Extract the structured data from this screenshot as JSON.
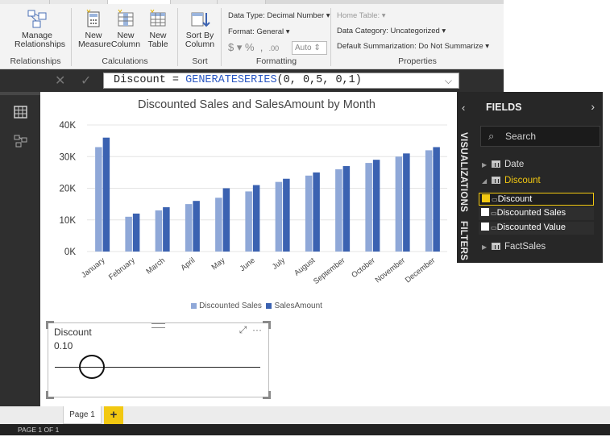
{
  "ribbon": {
    "groups": {
      "relationships": {
        "label": "Relationships",
        "button": "Manage\nRelationships"
      },
      "calculations": {
        "label": "Calculations",
        "new_measure": "New\nMeasure",
        "new_column": "New\nColumn",
        "new_table": "New\nTable"
      },
      "sort": {
        "label": "Sort",
        "sort_by_column": "Sort By\nColumn"
      },
      "formatting": {
        "label": "Formatting",
        "data_type": "Data Type: Decimal Number",
        "format": "Format: General",
        "auto": "Auto"
      },
      "properties": {
        "label": "Properties",
        "home_table": "Home Table:",
        "data_category": "Data Category: Uncategorized",
        "default_summarization": "Default Summarization: Do Not Summarize"
      }
    }
  },
  "formula": {
    "prefix": "Discount = ",
    "fn": "GENERATESERIES",
    "args": "(0, 0,5, 0,1)"
  },
  "chart_data": {
    "type": "bar",
    "title": "Discounted Sales and SalesAmount by Month",
    "categories": [
      "January",
      "February",
      "March",
      "April",
      "May",
      "June",
      "July",
      "August",
      "September",
      "October",
      "November",
      "December"
    ],
    "series": [
      {
        "name": "Discounted Sales",
        "color": "#8fa8d8",
        "values": [
          33000,
          11000,
          13000,
          15000,
          17000,
          19000,
          22000,
          24000,
          26000,
          28000,
          30000,
          32000
        ]
      },
      {
        "name": "SalesAmount",
        "color": "#3b62b1",
        "values": [
          36000,
          12000,
          14000,
          16000,
          20000,
          21000,
          23000,
          25000,
          27000,
          29000,
          31000,
          33000
        ]
      }
    ],
    "yticks": [
      "0K",
      "10K",
      "20K",
      "30K",
      "40K"
    ],
    "ylim": [
      0,
      40000
    ],
    "grid": true,
    "legend": "bottom"
  },
  "slicer": {
    "title": "Discount",
    "value": "0.10",
    "level": 0.2
  },
  "side": {
    "visualizations_label": "VISUALIZATIONS",
    "filters_label": "FILTERS"
  },
  "fields": {
    "header": "FIELDS",
    "search_placeholder": "Search",
    "tables": {
      "date": "Date",
      "discount": "Discount",
      "factsales": "FactSales"
    },
    "discount_fields": [
      "Discount",
      "Discounted Sales",
      "Discounted Value"
    ]
  },
  "pages": {
    "tab": "Page 1",
    "add": "+",
    "status": "PAGE 1 OF 1"
  },
  "colors": {
    "accent": "#f2c811",
    "bar_light": "#8fa8d8",
    "bar_dark": "#3b62b1"
  }
}
